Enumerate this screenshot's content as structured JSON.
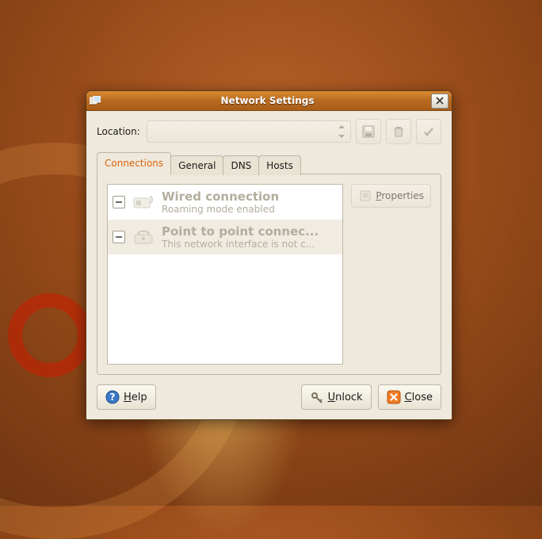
{
  "window": {
    "title": "Network Settings"
  },
  "location": {
    "label": "Location:",
    "value": ""
  },
  "tabs": [
    {
      "label": "Connections",
      "active": true
    },
    {
      "label": "General",
      "active": false
    },
    {
      "label": "DNS",
      "active": false
    },
    {
      "label": "Hosts",
      "active": false
    }
  ],
  "connections": [
    {
      "title": "Wired connection",
      "subtitle": "Roaming mode enabled",
      "icon": "nic-icon"
    },
    {
      "title": "Point to point connec...",
      "subtitle": "This network interface is not c...",
      "icon": "modem-icon"
    }
  ],
  "properties_label": "Properties",
  "buttons": {
    "help": "Help",
    "unlock": "Unlock",
    "close": "Close"
  }
}
